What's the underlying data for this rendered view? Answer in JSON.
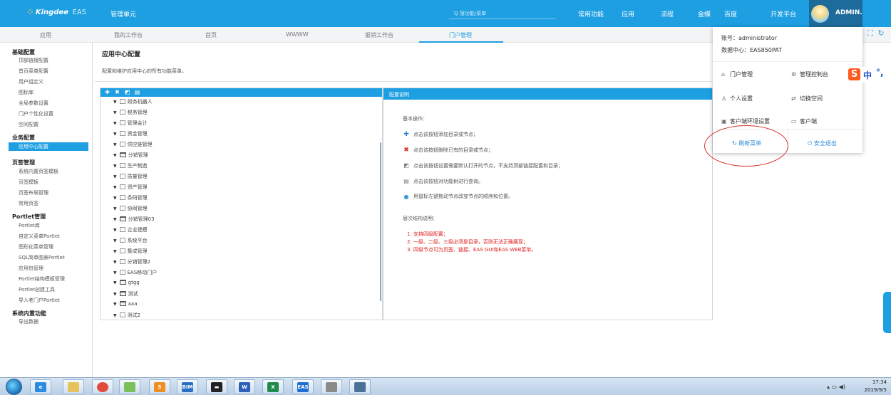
{
  "header": {
    "logo_text": "Kingdee",
    "logo_suffix": "EAS",
    "unit_title": "管理单元",
    "search_placeholder": "Q  搜功能/菜单",
    "nav": [
      "常用功能",
      "应用",
      "流程",
      "金蝶",
      "百度",
      "开发平台"
    ],
    "user_name": "ADMIN."
  },
  "tabs": [
    "应用",
    "我的工作台",
    "首页",
    "WWWW",
    "报销工作台",
    "门户管理"
  ],
  "active_tab": "门户管理",
  "sidebar": {
    "groups": [
      {
        "title": "基础配置",
        "items": [
          "顶部链接配置",
          "首页菜单配置",
          "用户组定义",
          "图标库",
          "全局参数设置",
          "门户个性化设置",
          "空间配置"
        ]
      },
      {
        "title": "业务配置",
        "items": [
          "应用中心配置"
        ]
      },
      {
        "title": "页签管理",
        "items": [
          "系统内置页签模板",
          "页签模板",
          "页签布局管理",
          "常用页签"
        ]
      },
      {
        "title": "Portlet管理",
        "items": [
          "Portlet库",
          "自定义菜单Portlet",
          "图形化菜单管理",
          "SQL简单图表Portlet",
          "应用包管理",
          "Portlet结构模板管理",
          "Portlet创建工具",
          "导入老门户Portlet"
        ]
      },
      {
        "title": "系统内置功能",
        "items": [
          "导出数据"
        ]
      }
    ],
    "active_item": "应用中心配置"
  },
  "main": {
    "title": "应用中心配置",
    "description": "配置和维护应用中心的所有功能菜单。",
    "tree_nodes": [
      {
        "label": "财务机器人",
        "type": "item"
      },
      {
        "label": "税务管理",
        "type": "item"
      },
      {
        "label": "管理会计",
        "type": "item"
      },
      {
        "label": "资金管理",
        "type": "item"
      },
      {
        "label": "供应链管理",
        "type": "item"
      },
      {
        "label": "分销管理",
        "type": "folder"
      },
      {
        "label": "生产制造",
        "type": "item"
      },
      {
        "label": "质量管理",
        "type": "item"
      },
      {
        "label": "资产管理",
        "type": "item"
      },
      {
        "label": "条码管理",
        "type": "item"
      },
      {
        "label": "协同管理",
        "type": "item"
      },
      {
        "label": "分销管理03",
        "type": "folder"
      },
      {
        "label": "企业建模",
        "type": "item"
      },
      {
        "label": "系统平台",
        "type": "item"
      },
      {
        "label": "集成管理",
        "type": "item"
      },
      {
        "label": "分销管理2",
        "type": "item"
      },
      {
        "label": "EAS移动门户",
        "type": "item"
      },
      {
        "label": "gtgg",
        "type": "folder"
      },
      {
        "label": "测试",
        "type": "folder"
      },
      {
        "label": "aaa",
        "type": "folder"
      },
      {
        "label": "测试2",
        "type": "item"
      }
    ],
    "help": {
      "header": "配置说明",
      "basic_title": "基本操作：",
      "ops": [
        {
          "icon": "add-icon",
          "text": "点击该按钮添加目录或节点；"
        },
        {
          "icon": "delete-icon",
          "text": "点击该按钮删除已有的目录或节点；"
        },
        {
          "icon": "default-open-icon",
          "text": "点击该按钮设置需要默认打开的节点，不支持顶部链接配置和目录；"
        },
        {
          "icon": "query-icon",
          "text": "点击该按钮对功能树进行查询。"
        },
        {
          "icon": "drag-icon",
          "text": "用鼠标左键拖动节点改变节点的顺序和位置。"
        }
      ],
      "structure_title": "层次结构说明：",
      "rules": [
        "1. 支持四级配置；",
        "2. 一级、二级、三级必须是目录，否则无法正确展现；",
        "3. 四级节点可为页签、链接、EAS GUI和EAS WEB菜单。"
      ]
    }
  },
  "dropdown": {
    "account": "账号：administrator",
    "datacenter": "数据中心：EAS850PAT",
    "items": [
      {
        "icon": "portal-icon",
        "label": "门户管理"
      },
      {
        "icon": "console-icon",
        "label": "管理控制台"
      },
      {
        "icon": "person-icon",
        "label": "个人设置"
      },
      {
        "icon": "switch-space-icon",
        "label": "切换空间"
      },
      {
        "icon": "client-env-icon",
        "label": "客户端环境设置"
      },
      {
        "icon": "client-icon",
        "label": "客户端"
      }
    ],
    "refresh_label": "刷新菜单",
    "logout_label": "安全退出"
  },
  "ime": {
    "logo": "S",
    "mode": "中",
    "punct": "°,"
  },
  "taskbar": {
    "time": "17:34",
    "date": "2019/9/5",
    "apps": [
      "ie-icon",
      "folder-icon",
      "chrome-icon",
      "notepad-icon",
      "sublime-icon",
      "bim-icon",
      "cmd-icon",
      "word-icon",
      "excel-icon",
      "eas-icon",
      "app-icon",
      "screen-icon"
    ]
  },
  "colors": {
    "accent": "#1e9fe2",
    "user_block": "#1d6b9a",
    "rule_red": "#e02020",
    "annotation_red": "#d9332b"
  }
}
